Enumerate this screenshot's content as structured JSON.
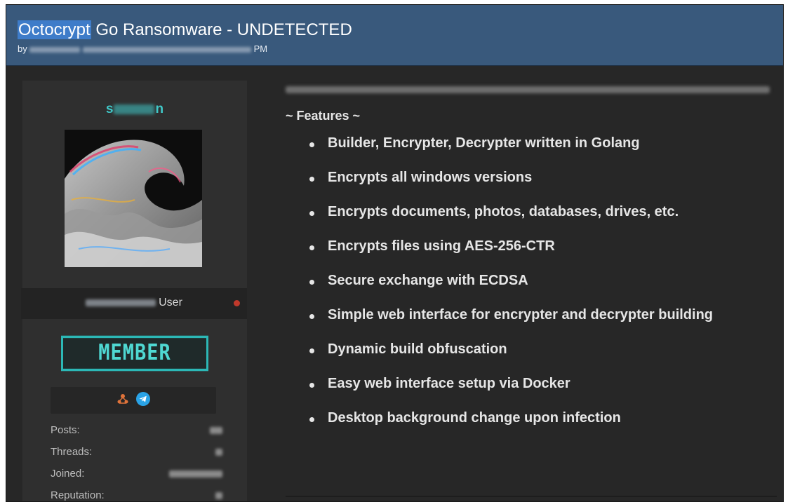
{
  "thread": {
    "title_highlight": "Octocrypt",
    "title_rest": " Go Ransomware - UNDETECTED",
    "meta_prefix": "by",
    "meta_suffix": "PM"
  },
  "user": {
    "name_start": "s",
    "name_end": "n",
    "role": "User",
    "rank_badge": "MEMBER",
    "stats": [
      {
        "label": "Posts:"
      },
      {
        "label": "Threads:"
      },
      {
        "label": "Joined:"
      },
      {
        "label": "Reputation:"
      }
    ]
  },
  "post": {
    "features_heading": "~ Features ~",
    "features": [
      "Builder, Encrypter, Decrypter written in Golang",
      "Encrypts all windows versions",
      "Encrypts documents, photos, databases, drives, etc.",
      "Encrypts files using AES-256-CTR",
      "Secure exchange with ECDSA",
      "Simple web interface for encrypter and decrypter building",
      "Dynamic build obfuscation",
      "Easy web interface setup via Docker",
      "Desktop background change upon infection"
    ]
  },
  "colors": {
    "header_bg": "#39597c",
    "title_highlight_bg": "#3e7cc9",
    "username": "#40c8c8",
    "member_badge": "#2cb8b6",
    "page_bg": "#272727",
    "online_dot": "#c0392b"
  },
  "icons": [
    "user-network-icon",
    "telegram-icon"
  ]
}
